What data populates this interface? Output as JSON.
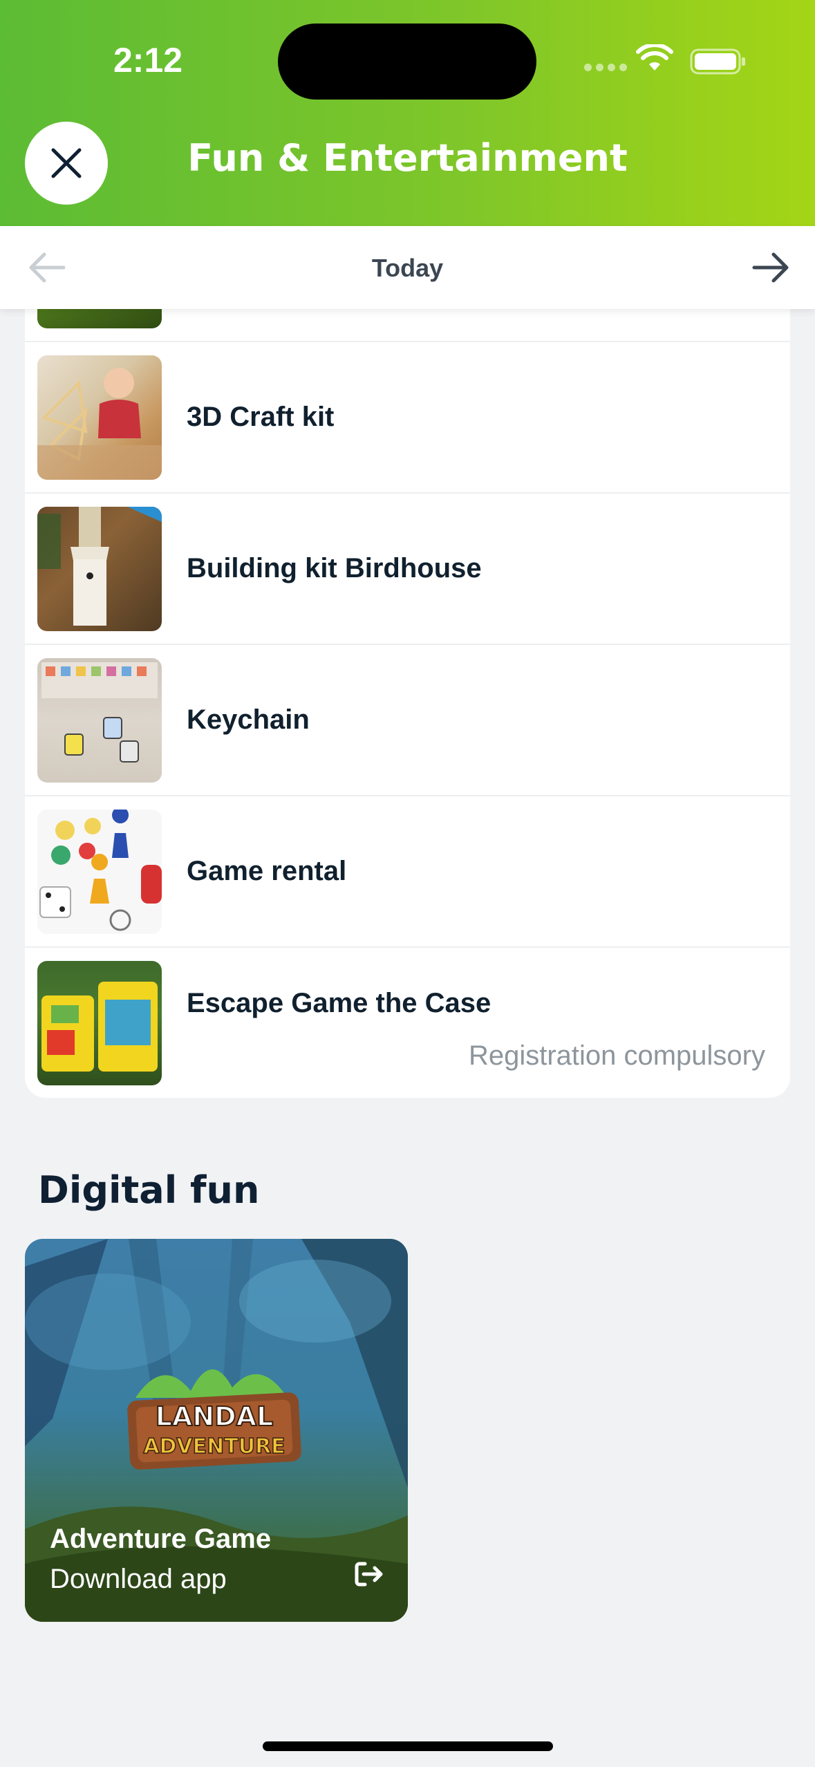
{
  "status_bar": {
    "time": "2:12"
  },
  "header": {
    "title": "Fun & Entertainment"
  },
  "date_nav": {
    "label": "Today"
  },
  "list": [
    {
      "title": "3D Craft kit",
      "subtitle": ""
    },
    {
      "title": "Building kit Birdhouse",
      "subtitle": ""
    },
    {
      "title": "Keychain",
      "subtitle": ""
    },
    {
      "title": "Game rental",
      "subtitle": ""
    },
    {
      "title": "Escape Game the Case",
      "subtitle": "Registration compulsory"
    }
  ],
  "digital_section": {
    "title": "Digital fun",
    "card": {
      "logo_line1": "LANDAL",
      "logo_line2": "ADVENTURE",
      "title": "Adventure Game",
      "subtitle": "Download app"
    }
  },
  "colors": {
    "header_start": "#5cbc34",
    "header_end": "#a4d516",
    "text_dark": "#10202e",
    "muted": "#8d959c"
  }
}
